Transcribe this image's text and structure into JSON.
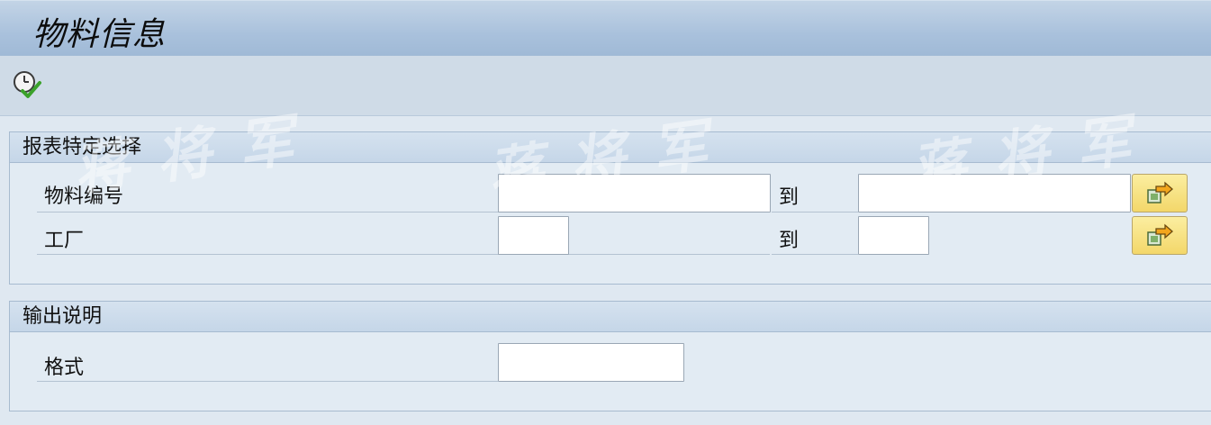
{
  "window": {
    "title": "物料信息"
  },
  "toolbar": {
    "execute_icon": "execute-clock-check-icon"
  },
  "selection_panel": {
    "title": "报表特定选择",
    "rows": [
      {
        "label": "物料编号",
        "to_label": "到",
        "from_value": "",
        "to_value": ""
      },
      {
        "label": "工厂",
        "to_label": "到",
        "from_value": "",
        "to_value": ""
      }
    ],
    "multi_select_icon": "multiple-selection-arrow-icon"
  },
  "output_panel": {
    "title": "输出说明",
    "rows": [
      {
        "label": "格式",
        "value": ""
      }
    ]
  },
  "watermark": {
    "text": "蒋将军"
  },
  "colors": {
    "title_bar": "#a9c1dc",
    "background": "#dfe8f1",
    "button": "#f3d76a",
    "check_green": "#3ba22b"
  }
}
